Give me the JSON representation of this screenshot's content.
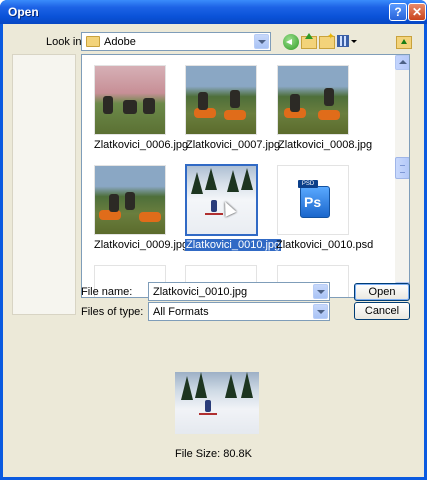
{
  "window": {
    "title": "Open",
    "help_label": "?",
    "close_label": "✕"
  },
  "toolbar": {
    "lookin_label": "Look in:",
    "lookin_value": "Adobe",
    "icons": [
      "back-icon",
      "up-folder-icon",
      "new-folder-icon",
      "views-menu-icon",
      "folder-up-icon"
    ]
  },
  "files": [
    {
      "name": "Zlatkovici_0006.jpg",
      "kind": "photo-red",
      "selected": false
    },
    {
      "name": "Zlatkovici_0007.jpg",
      "kind": "photo-moto",
      "selected": false
    },
    {
      "name": "Zlatkovici_0008.jpg",
      "kind": "photo-moto",
      "selected": false
    },
    {
      "name": "Zlatkovici_0009.jpg",
      "kind": "photo-moto",
      "selected": false
    },
    {
      "name": "Zlatkovici_0010.jpg",
      "kind": "photo-snow",
      "selected": true
    },
    {
      "name": "Zlatkovici_0010.psd",
      "kind": "psd",
      "selected": false
    }
  ],
  "psd_tag": "PSD",
  "psd_logo": "Ps",
  "form": {
    "filename_label": "File name:",
    "filename_value": "Zlatkovici_0010.jpg",
    "filetype_label": "Files of type:",
    "filetype_value": "All Formats",
    "open_label": "Open",
    "cancel_label": "Cancel"
  },
  "preview": {
    "file_size": "File Size: 80.8K"
  },
  "colors": {
    "titlebar": "#0a52d8",
    "selection": "#316ac5",
    "dialog_bg": "#ece9d8"
  }
}
